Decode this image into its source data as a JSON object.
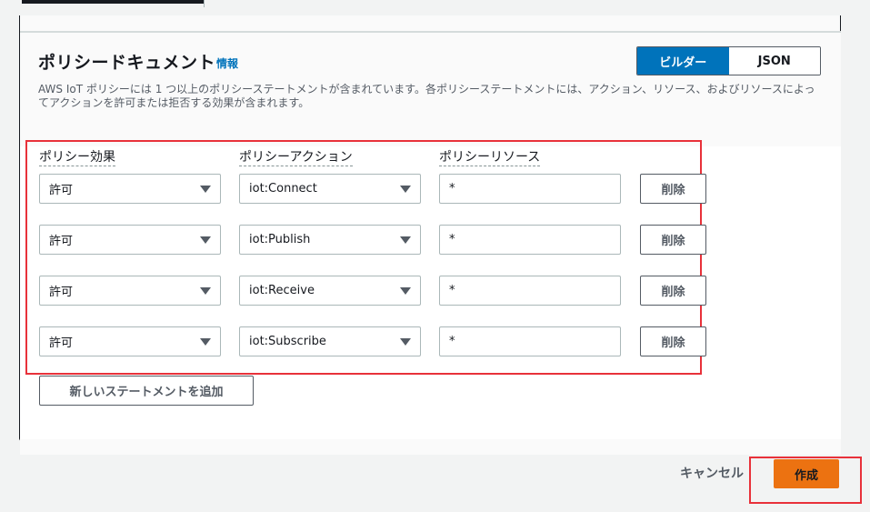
{
  "section": {
    "title": "ポリシードキュメント",
    "info_link": "情報",
    "description": "AWS IoT ポリシーには 1 つ以上のポリシーステートメントが含まれています。各ポリシーステートメントには、アクション、リソース、およびリソースによってアクションを許可または拒否する効果が含まれます。"
  },
  "mode_toggle": {
    "builder": "ビルダー",
    "json": "JSON",
    "active": "builder"
  },
  "columns": {
    "effect": "ポリシー効果",
    "action": "ポリシーアクション",
    "resource": "ポリシーリソース"
  },
  "statements": [
    {
      "effect": "許可",
      "action": "iot:Connect",
      "resource": "*",
      "delete_label": "削除"
    },
    {
      "effect": "許可",
      "action": "iot:Publish",
      "resource": "*",
      "delete_label": "削除"
    },
    {
      "effect": "許可",
      "action": "iot:Receive",
      "resource": "*",
      "delete_label": "削除"
    },
    {
      "effect": "許可",
      "action": "iot:Subscribe",
      "resource": "*",
      "delete_label": "削除"
    }
  ],
  "add_statement_label": "新しいステートメントを追加",
  "footer": {
    "cancel_label": "キャンセル",
    "create_label": "作成"
  },
  "colors": {
    "accent": "#0073bb",
    "primary_button": "#ec7211",
    "highlight": "#e8313a"
  }
}
